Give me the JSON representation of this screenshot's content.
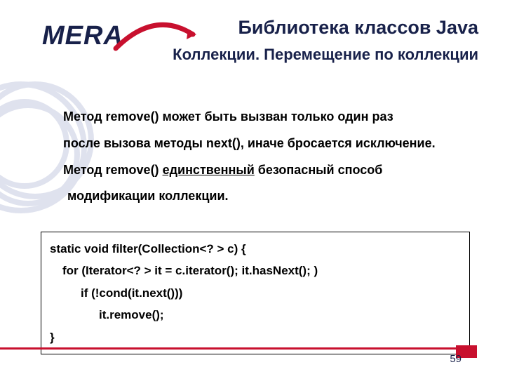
{
  "logo": {
    "text": "MERA"
  },
  "title": "Библиотека классов Java",
  "subtitle": "Коллекции. Перемещение по коллекции",
  "body": {
    "p1a": "Метод remove() может быть вызван только один раз",
    "p1b": "после вызова методы next(), иначе бросается исключение.",
    "p2a_prefix": "Метод remove() ",
    "p2a_under": "единственный",
    "p2a_suffix": " безопасный способ",
    "p2b": "модификации коллекции."
  },
  "code": {
    "l1": "static void filter(Collection<? > c) {",
    "l2": "for (Iterator<? > it = c.iterator(); it.hasNext(); )",
    "l3": "if (!cond(it.next()))",
    "l4": "it.remove();",
    "l5": "}"
  },
  "page_number": "59"
}
